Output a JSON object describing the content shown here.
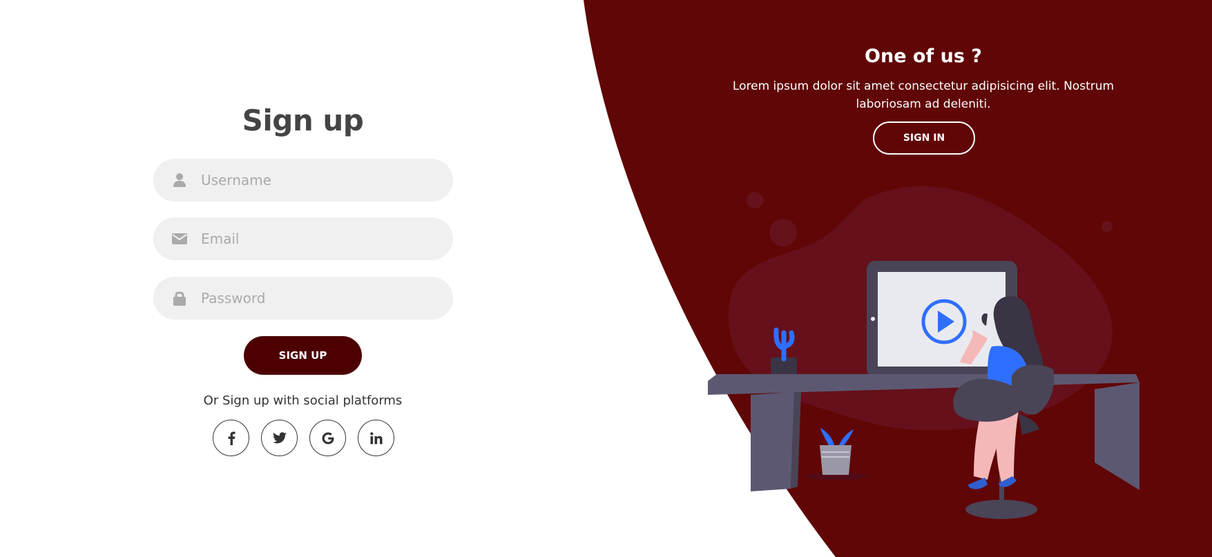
{
  "signup": {
    "title": "Sign up",
    "username_placeholder": "Username",
    "email_placeholder": "Email",
    "password_placeholder": "Password",
    "submit_label": "SIGN UP",
    "social_text": "Or Sign up with social platforms",
    "social_icons": [
      "facebook-icon",
      "twitter-icon",
      "google-icon",
      "linkedin-icon"
    ]
  },
  "panel": {
    "title": "One of us ?",
    "description": "Lorem ipsum dolor sit amet consectetur adipisicing elit. Nostrum laboriosam ad deleniti.",
    "signin_label": "SIGN IN"
  },
  "colors": {
    "accent": "#600606",
    "button": "#4d0000",
    "field_bg": "#f0f0f0",
    "illustration_blue": "#2f6fff"
  }
}
